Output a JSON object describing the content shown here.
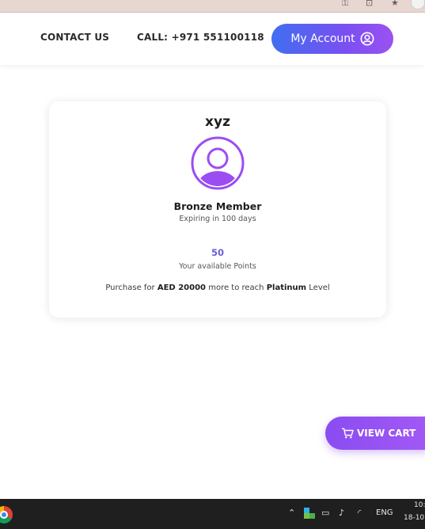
{
  "nav": {
    "contact_label": "CONTACT US",
    "call_label": "CALL: +971 551100118",
    "account_label": "My Account"
  },
  "profile": {
    "name": "xyz",
    "tier": "Bronze Member",
    "expiry": "Expiring in 100 days",
    "points": "50",
    "points_label": "Your available Points",
    "purchase_prefix": "Purchase for",
    "purchase_amount": "AED 20000",
    "purchase_middle": "more to reach",
    "target_level": "Platinum",
    "purchase_suffix": "Level"
  },
  "cart": {
    "label": "VIEW CART"
  },
  "taskbar": {
    "language": "ENG",
    "time": "10:",
    "date": "18-10"
  },
  "colors": {
    "accent_purple": "#8a4cf0",
    "accent_blue": "#3f6ff0",
    "points_color": "#6a5fd6"
  }
}
